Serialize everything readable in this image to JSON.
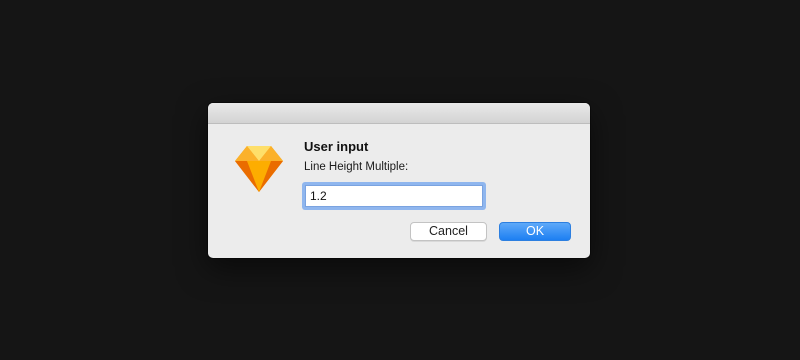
{
  "dialog": {
    "title": "User input",
    "message": "Line Height Multiple:",
    "input_value": "1.2",
    "cancel_label": "Cancel",
    "ok_label": "OK",
    "icon": "sketch-diamond-icon"
  },
  "colors": {
    "background": "#151515",
    "dialog": "#ececec",
    "ok_button": "#2a86f5",
    "focus_ring": "#8fb6ee",
    "icon_orange": "#f7a623"
  }
}
